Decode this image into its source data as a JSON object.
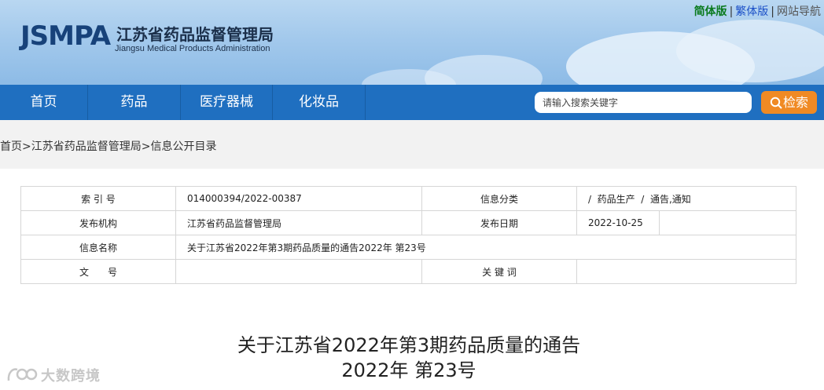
{
  "header": {
    "logo": "JSMPA",
    "site_name": "江苏省药品监督管理局",
    "site_name_en": "Jiangsu Medical Products Administration",
    "top_links": {
      "simplified": "简体版",
      "traditional": "繁体版",
      "site_nav": "网站导航",
      "separator": "|"
    }
  },
  "nav": {
    "items": [
      {
        "label": "首页"
      },
      {
        "label": "药品"
      },
      {
        "label": "医疗器械"
      },
      {
        "label": "化妆品"
      }
    ],
    "search": {
      "placeholder": "请输入搜索关键字",
      "button_label": "检索"
    }
  },
  "breadcrumb": {
    "items": [
      "首页",
      "江苏省药品监督管理局",
      "信息公开目录"
    ],
    "separator": ">"
  },
  "info_table": {
    "index_label": "索 引 号",
    "index_value": "014000394/2022-00387",
    "category_label": "信息分类",
    "category_value": "/  药品生产  /  通告,通知",
    "publisher_label": "发布机构",
    "publisher_value": "江苏省药品监督管理局",
    "date_label": "发布日期",
    "date_value": "2022-10-25",
    "name_label": "信息名称",
    "name_value": "关于江苏省2022年第3期药品质量的通告2022年 第23号",
    "doc_no_label": "文　　号",
    "doc_no_value": "",
    "keywords_label": "关 键 词",
    "keywords_value": ""
  },
  "article": {
    "title_line1": "关于江苏省2022年第3期药品质量的通告",
    "title_line2": "2022年 第23号"
  },
  "watermark": {
    "text": "大数跨境"
  },
  "colors": {
    "nav_bg": "#1f6fc0",
    "search_button": "#f08a24",
    "logo": "#17427a",
    "simplified_link": "#0a7a1e",
    "traditional_link": "#1a4fc7"
  }
}
